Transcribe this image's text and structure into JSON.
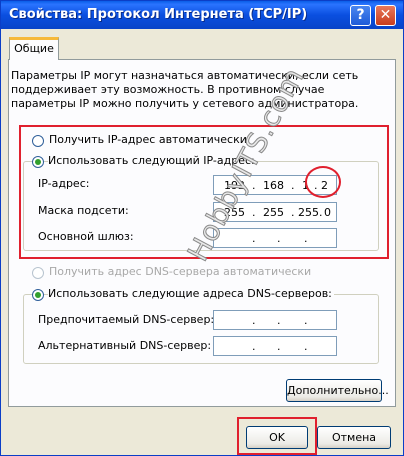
{
  "window": {
    "title": "Свойства: Протокол Интернета (TCP/IP)",
    "help_glyph": "?",
    "close_glyph": "✕"
  },
  "tabs": [
    "Общие"
  ],
  "description": "Параметры IP могут назначаться автоматически, если сеть поддерживает эту возможность. В противном случае параметры IP можно получить у сетевого администратора.",
  "ip_section": {
    "auto_label": "Получить IP-адрес автоматически",
    "manual_label": "Использовать следующий IP-адрес:",
    "selected": "manual",
    "fields": [
      {
        "label": "IP-адрес:",
        "octets": [
          "192",
          "168",
          "1",
          "2"
        ]
      },
      {
        "label": "Маска подсети:",
        "octets": [
          "255",
          "255",
          "255",
          "0"
        ]
      },
      {
        "label": "Основной шлюз:",
        "octets": [
          "",
          "",
          "",
          ""
        ]
      }
    ]
  },
  "dns_section": {
    "auto_label": "Получить адрес DNS-сервера автоматически",
    "manual_label": "Использовать следующие адреса DNS-серверов:",
    "selected": "manual",
    "fields": [
      {
        "label": "Предпочитаемый DNS-сервер:",
        "octets": [
          "",
          "",
          "",
          ""
        ]
      },
      {
        "label": "Альтернативный DNS-сервер:",
        "octets": [
          "",
          "",
          "",
          ""
        ]
      }
    ]
  },
  "buttons": {
    "advanced": "Дополнительно...",
    "ok": "OK",
    "cancel": "Отмена"
  },
  "watermark": "HobbyITS.com",
  "colors": {
    "highlight": "#e0202e",
    "title_bar": "#0a4fe0",
    "radio_dot": "#32a02e"
  }
}
